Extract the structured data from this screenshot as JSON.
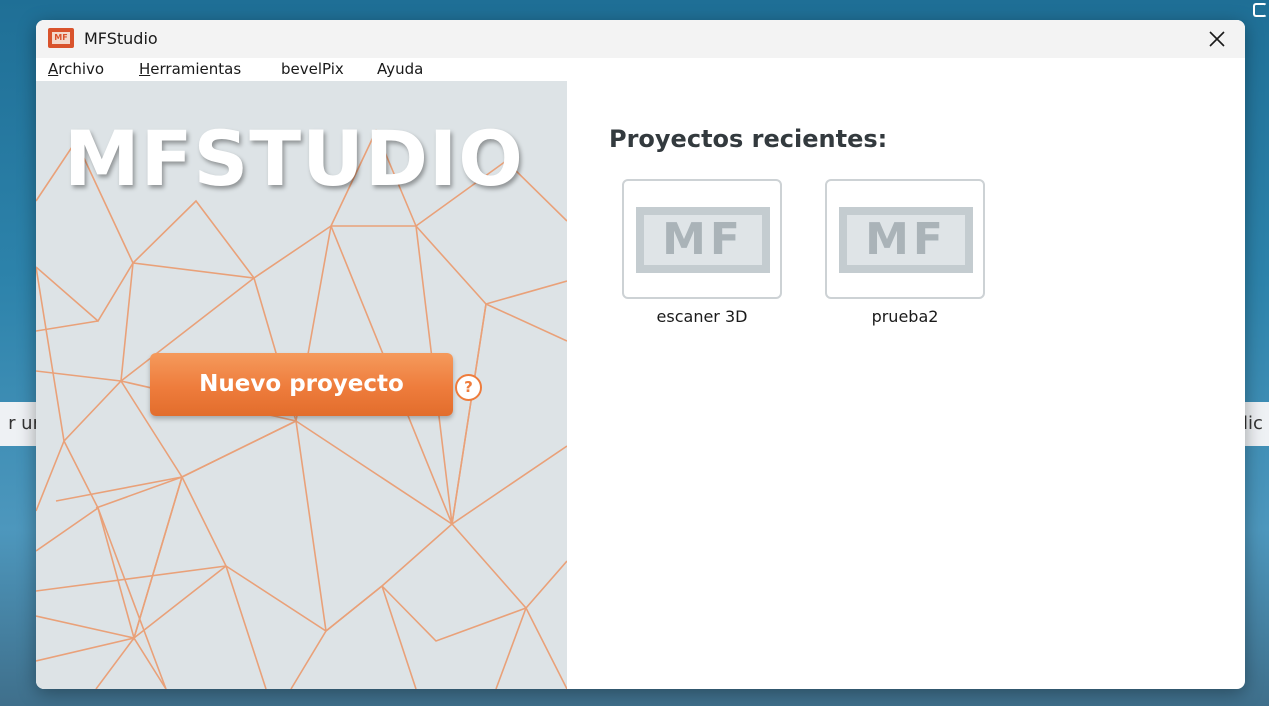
{
  "desktop": {
    "left_strip_text": "r ur",
    "right_strip_text": "lic"
  },
  "window": {
    "title": "MFStudio",
    "logo_text": "MF"
  },
  "menu": {
    "items": [
      {
        "label": "Archivo",
        "accel": "A",
        "rest": "rchivo"
      },
      {
        "label": "Herramientas",
        "accel": "H",
        "rest": "erramientas"
      },
      {
        "label": "bevelPix"
      },
      {
        "label": "Ayuda"
      }
    ]
  },
  "left_panel": {
    "brand": "MFSTUDIO",
    "new_project_label": "Nuevo proyecto",
    "help_symbol": "?"
  },
  "recent": {
    "title": "Proyectos recientes:",
    "projects": [
      {
        "name": "escaner 3D",
        "thumb_text": "MF"
      },
      {
        "name": "prueba2",
        "thumb_text": "MF"
      }
    ]
  },
  "colors": {
    "accent": "#ee7c3c",
    "mesh_line": "#eb9a6e",
    "panel_bg": "#dde3e6"
  },
  "icons": {
    "close": "close-icon",
    "help": "help-icon",
    "app": "mfstudio-logo-icon"
  }
}
